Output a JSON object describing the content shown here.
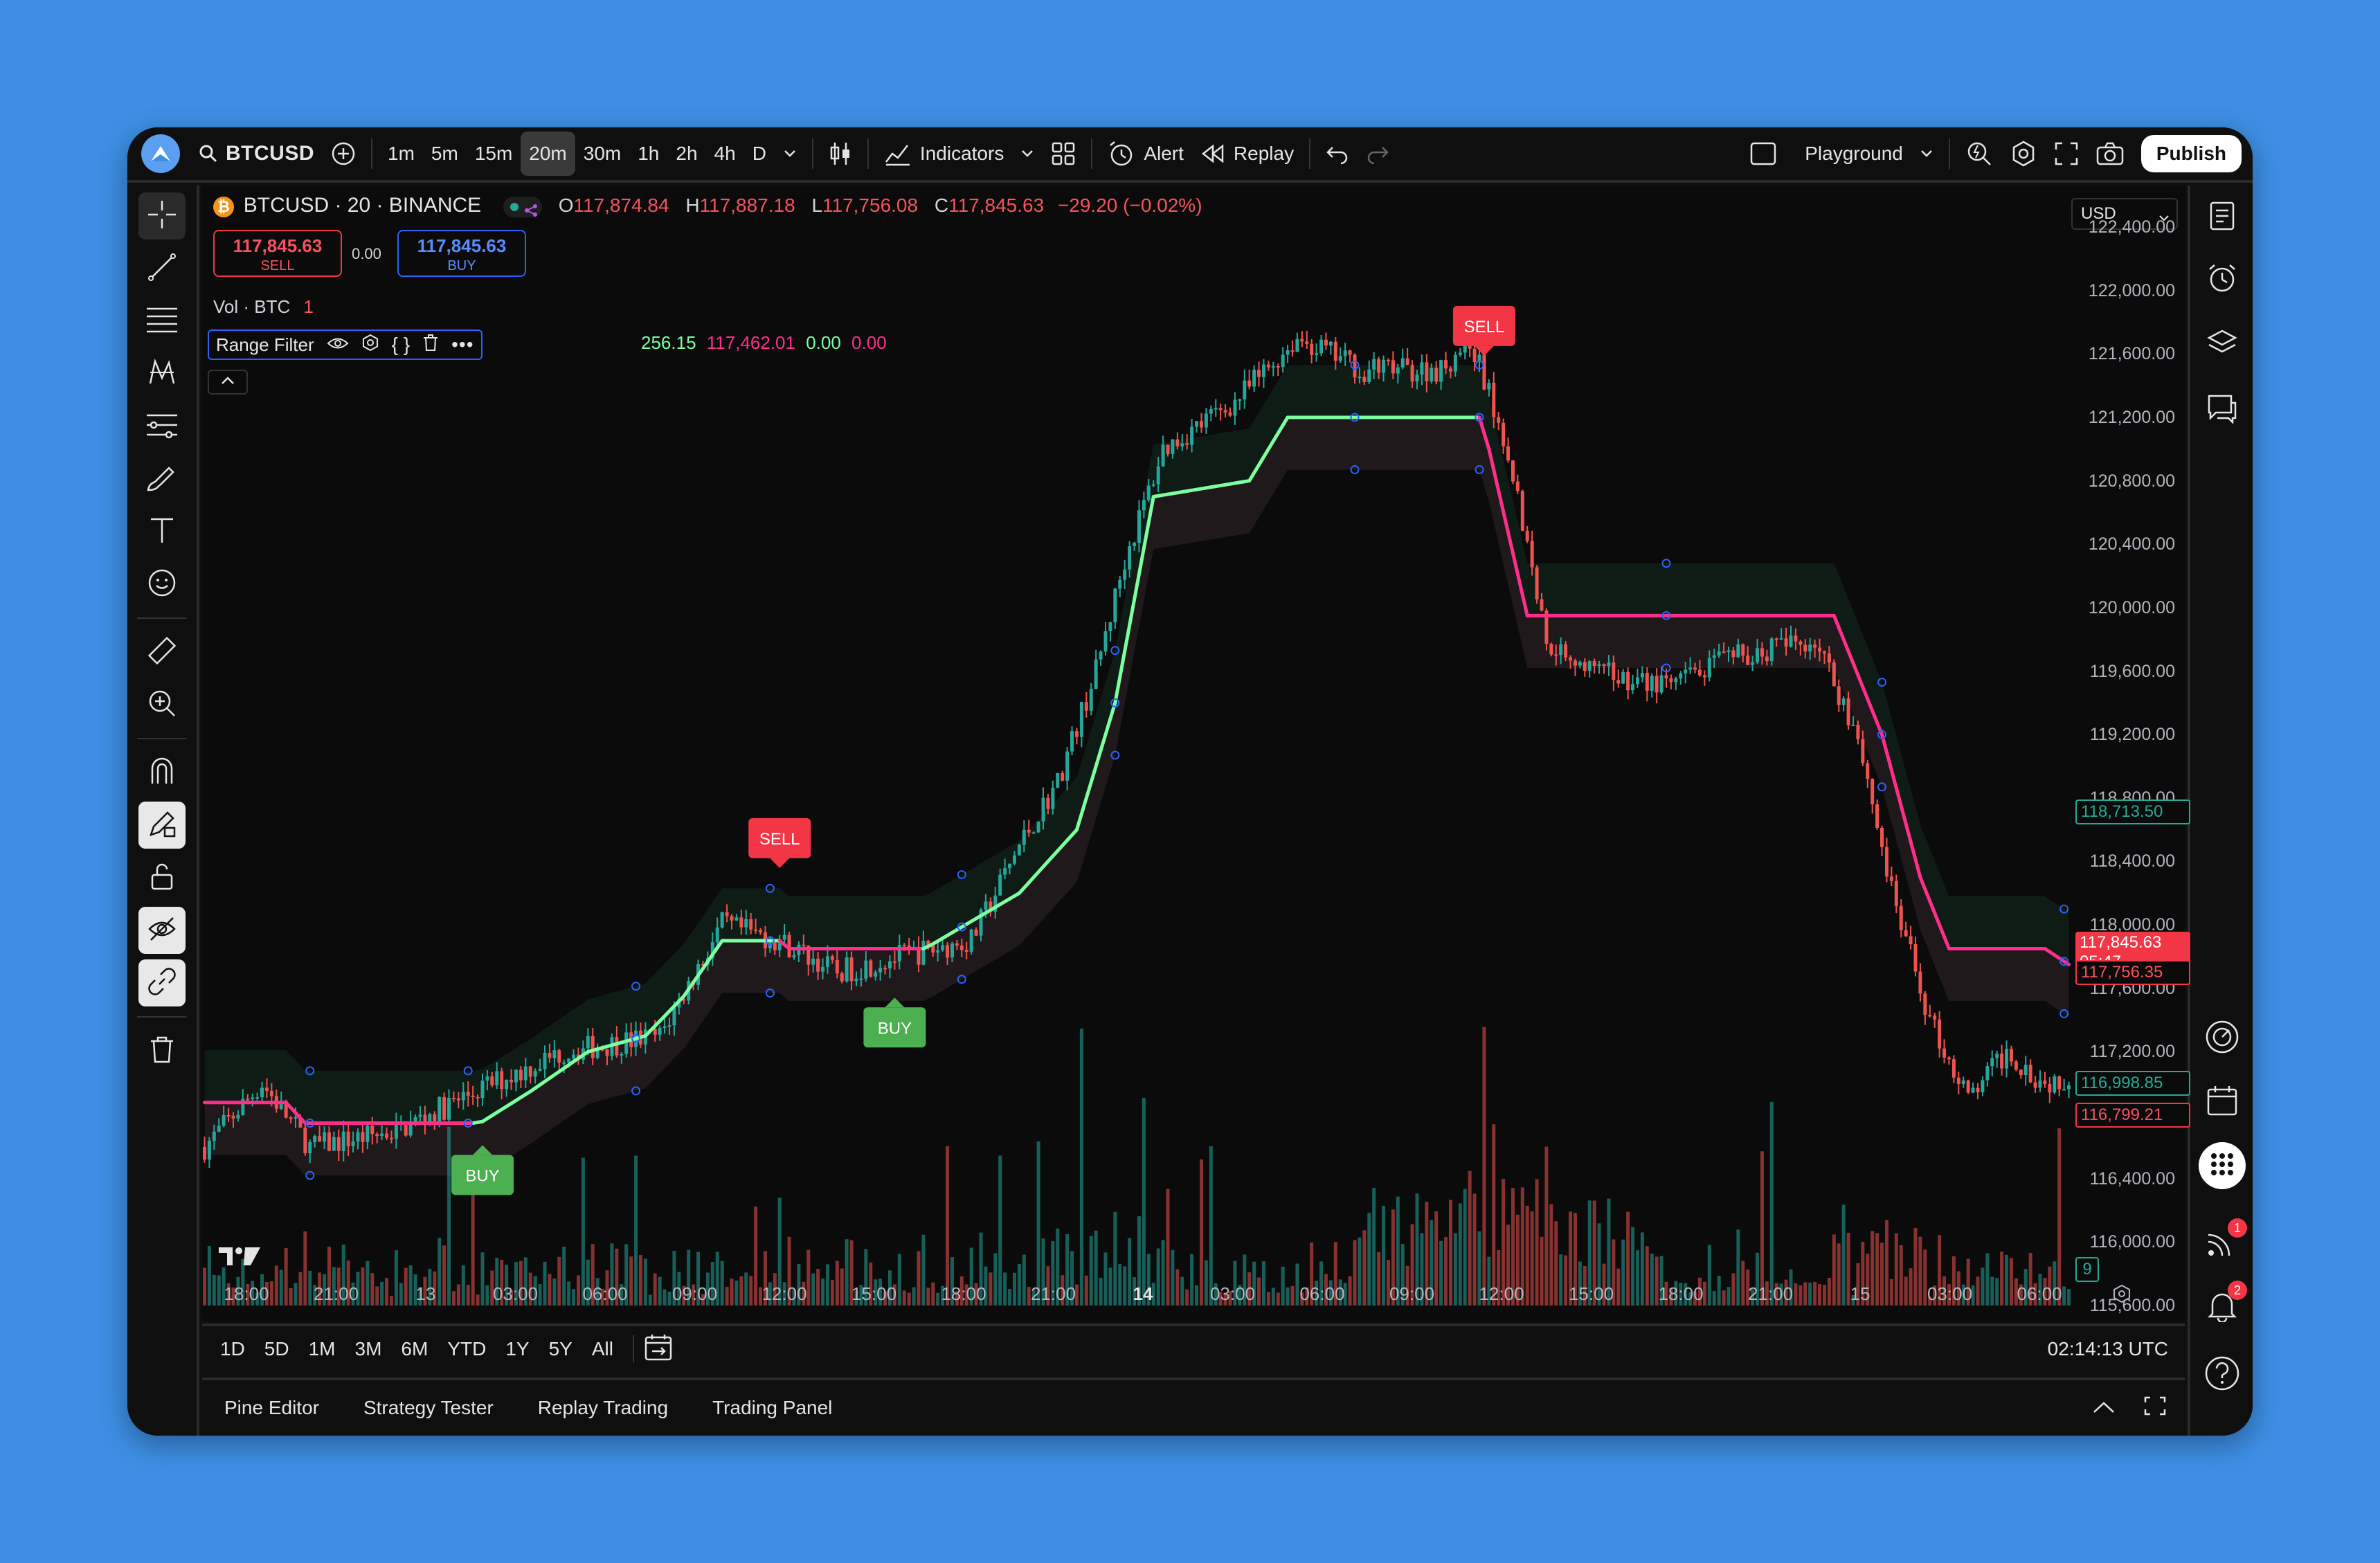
{
  "topbar": {
    "symbol": "BTCUSD",
    "timeframes": [
      "1m",
      "5m",
      "15m",
      "20m",
      "30m",
      "1h",
      "2h",
      "4h",
      "D"
    ],
    "active_timeframe": "20m",
    "indicators_label": "Indicators",
    "alert_label": "Alert",
    "replay_label": "Replay",
    "layout_label": "Playground",
    "publish_label": "Publish"
  },
  "legend": {
    "title": "BTCUSD · 20 · BINANCE",
    "o_label": "O",
    "o": "117,874.84",
    "h_label": "H",
    "h": "117,887.18",
    "l_label": "L",
    "l": "117,756.08",
    "c_label": "C",
    "c": "117,845.63",
    "change": "−29.20 (−0.02%)",
    "sell_price": "117,845.63",
    "sell_label": "SELL",
    "spread": "0.00",
    "buy_price": "117,845.63",
    "buy_label": "BUY",
    "vol_label": "Vol · BTC",
    "vol_value": "1",
    "indicator_name": "Range Filter",
    "ind_v1": "256.15",
    "ind_v2": "117,462.01",
    "ind_v3": "0.00",
    "ind_v4": "0.00",
    "currency": "USD"
  },
  "yaxis": {
    "labels": [
      "122,400.00",
      "122,000.00",
      "121,600.00",
      "121,200.00",
      "120,800.00",
      "120,400.00",
      "120,000.00",
      "119,600.00",
      "119,200.00",
      "118,800.00",
      "118,400.00",
      "118,000.00",
      "117,600.00",
      "117,200.00",
      "116,800.00",
      "116,400.00",
      "116,000.00",
      "115,600.00"
    ],
    "tag_green_top": "118,713.50",
    "tag_last": "117,845.63",
    "tag_countdown": "05:47",
    "tag_low": "117,756.35",
    "tag_green_bottom": "116,998.85",
    "tag_red_bottom": "116,799.21",
    "tag_vol": "9"
  },
  "xaxis": {
    "labels": [
      "18:00",
      "21:00",
      "13",
      "03:00",
      "06:00",
      "09:00",
      "12:00",
      "15:00",
      "18:00",
      "21:00",
      "14",
      "03:00",
      "06:00",
      "09:00",
      "12:00",
      "15:00",
      "18:00",
      "21:00",
      "15",
      "03:00",
      "06:00"
    ]
  },
  "signals": {
    "buy": "BUY",
    "sell": "SELL"
  },
  "rangebar": {
    "ranges": [
      "1D",
      "5D",
      "1M",
      "3M",
      "6M",
      "YTD",
      "1Y",
      "5Y",
      "All"
    ],
    "time": "02:14:13 UTC"
  },
  "bottom_tabs": [
    "Pine Editor",
    "Strategy Tester",
    "Replay Trading",
    "Trading Panel"
  ],
  "badges": {
    "stream": "1",
    "notifications": "2"
  },
  "colors": {
    "up": "#26a69a",
    "down": "#ef5350",
    "filter_up": "#7dffa0",
    "filter_down": "#ff2e8a",
    "accent": "#2962ff"
  },
  "chart_data": {
    "type": "candlestick",
    "ylim": [
      115600,
      122400
    ],
    "x_ticks": [
      "18:00",
      "21:00",
      "13",
      "03:00",
      "06:00",
      "09:00",
      "12:00",
      "15:00",
      "18:00",
      "21:00",
      "14",
      "03:00",
      "06:00",
      "09:00",
      "12:00",
      "15:00",
      "18:00",
      "21:00",
      "15",
      "03:00",
      "06:00"
    ],
    "anchors": [
      {
        "i": 0,
        "p": 116600
      },
      {
        "i": 12,
        "p": 117000
      },
      {
        "i": 22,
        "p": 116600
      },
      {
        "i": 40,
        "p": 116700
      },
      {
        "i": 60,
        "p": 117000
      },
      {
        "i": 75,
        "p": 117200
      },
      {
        "i": 95,
        "p": 117300
      },
      {
        "i": 108,
        "p": 118000
      },
      {
        "i": 120,
        "p": 117900
      },
      {
        "i": 132,
        "p": 117700
      },
      {
        "i": 145,
        "p": 117800
      },
      {
        "i": 160,
        "p": 117900
      },
      {
        "i": 170,
        "p": 118500
      },
      {
        "i": 178,
        "p": 118900
      },
      {
        "i": 186,
        "p": 119600
      },
      {
        "i": 192,
        "p": 120300
      },
      {
        "i": 200,
        "p": 121000
      },
      {
        "i": 215,
        "p": 121300
      },
      {
        "i": 228,
        "p": 121700
      },
      {
        "i": 242,
        "p": 121500
      },
      {
        "i": 258,
        "p": 121500
      },
      {
        "i": 264,
        "p": 121700
      },
      {
        "i": 272,
        "p": 121000
      },
      {
        "i": 280,
        "p": 119800
      },
      {
        "i": 290,
        "p": 119600
      },
      {
        "i": 305,
        "p": 119500
      },
      {
        "i": 320,
        "p": 119700
      },
      {
        "i": 336,
        "p": 119800
      },
      {
        "i": 345,
        "p": 119200
      },
      {
        "i": 352,
        "p": 118200
      },
      {
        "i": 360,
        "p": 117400
      },
      {
        "i": 368,
        "p": 116900
      },
      {
        "i": 376,
        "p": 117200
      },
      {
        "i": 384,
        "p": 117000
      },
      {
        "i": 389,
        "p": 117050
      }
    ],
    "candle_count": 390,
    "filter_line": [
      {
        "i": 0,
        "p": 116880,
        "dir": "down"
      },
      {
        "i": 17,
        "p": 116880,
        "dir": "down"
      },
      {
        "i": 21,
        "p": 116750,
        "dir": "down"
      },
      {
        "i": 56,
        "p": 116750,
        "dir": "down"
      },
      {
        "i": 58,
        "p": 116760,
        "dir": "up"
      },
      {
        "i": 68,
        "p": 116950,
        "dir": "up"
      },
      {
        "i": 80,
        "p": 117200,
        "dir": "up"
      },
      {
        "i": 92,
        "p": 117300,
        "dir": "up"
      },
      {
        "i": 100,
        "p": 117550,
        "dir": "up"
      },
      {
        "i": 108,
        "p": 117900,
        "dir": "up"
      },
      {
        "i": 120,
        "p": 117900,
        "dir": "up"
      },
      {
        "i": 122,
        "p": 117850,
        "dir": "down"
      },
      {
        "i": 150,
        "p": 117850,
        "dir": "down"
      },
      {
        "i": 152,
        "p": 117880,
        "dir": "up"
      },
      {
        "i": 170,
        "p": 118200,
        "dir": "up"
      },
      {
        "i": 182,
        "p": 118600,
        "dir": "up"
      },
      {
        "i": 190,
        "p": 119400,
        "dir": "up"
      },
      {
        "i": 198,
        "p": 120700,
        "dir": "up"
      },
      {
        "i": 218,
        "p": 120800,
        "dir": "up"
      },
      {
        "i": 226,
        "p": 121200,
        "dir": "up"
      },
      {
        "i": 266,
        "p": 121200,
        "dir": "up"
      },
      {
        "i": 268,
        "p": 121000,
        "dir": "down"
      },
      {
        "i": 276,
        "p": 119950,
        "dir": "down"
      },
      {
        "i": 340,
        "p": 119950,
        "dir": "down"
      },
      {
        "i": 350,
        "p": 119200,
        "dir": "down"
      },
      {
        "i": 358,
        "p": 118300,
        "dir": "down"
      },
      {
        "i": 364,
        "p": 117850,
        "dir": "down"
      },
      {
        "i": 384,
        "p": 117850,
        "dir": "down"
      },
      {
        "i": 389,
        "p": 117750,
        "dir": "down"
      }
    ],
    "signals": [
      {
        "type": "BUY",
        "i": 58,
        "p": 116550
      },
      {
        "type": "SELL",
        "i": 120,
        "p": 118420
      },
      {
        "type": "BUY",
        "i": 144,
        "p": 117480
      },
      {
        "type": "SELL",
        "i": 267,
        "p": 121650
      }
    ]
  }
}
